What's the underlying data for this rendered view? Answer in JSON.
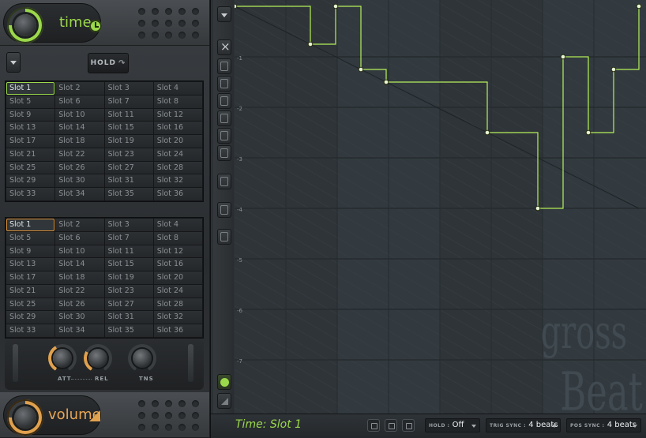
{
  "time_section": {
    "title": "time",
    "clock_icon": "clock-icon",
    "hold_label": "HOLD"
  },
  "time_slots": [
    "Slot 1",
    "Slot 2",
    "Slot 3",
    "Slot 4",
    "Slot 5",
    "Slot 6",
    "Slot 7",
    "Slot 8",
    "Slot 9",
    "Slot 10",
    "Slot 11",
    "Slot 12",
    "Slot 13",
    "Slot 14",
    "Slot 15",
    "Slot 16",
    "Slot 17",
    "Slot 18",
    "Slot 19",
    "Slot 20",
    "Slot 21",
    "Slot 22",
    "Slot 23",
    "Slot 24",
    "Slot 25",
    "Slot 26",
    "Slot 27",
    "Slot 28",
    "Slot 29",
    "Slot 30",
    "Slot 31",
    "Slot 32",
    "Slot 33",
    "Slot 34",
    "Slot 35",
    "Slot 36"
  ],
  "time_selected_slot": "Slot 1",
  "volume_slots": [
    "Slot 1",
    "Slot 2",
    "Slot 3",
    "Slot 4",
    "Slot 5",
    "Slot 6",
    "Slot 7",
    "Slot 8",
    "Slot 9",
    "Slot 10",
    "Slot 11",
    "Slot 12",
    "Slot 13",
    "Slot 14",
    "Slot 15",
    "Slot 16",
    "Slot 17",
    "Slot 18",
    "Slot 19",
    "Slot 20",
    "Slot 21",
    "Slot 22",
    "Slot 23",
    "Slot 24",
    "Slot 25",
    "Slot 26",
    "Slot 27",
    "Slot 28",
    "Slot 29",
    "Slot 30",
    "Slot 31",
    "Slot 32",
    "Slot 33",
    "Slot 34",
    "Slot 35",
    "Slot 36"
  ],
  "volume_selected_slot": "Slot 1",
  "knobs": {
    "att_label": "ATT",
    "rel_label": "REL",
    "tns_label": "TNS"
  },
  "volume_section": {
    "title": "volume"
  },
  "graph": {
    "y_labels": [
      "-1",
      "-2",
      "-3",
      "-4",
      "-5",
      "-6",
      "-7"
    ],
    "watermark_line1": "gross",
    "watermark_line2": "Beat",
    "colors": {
      "envelope": "#b6f05a",
      "accent_green": "#9bd84b",
      "accent_orange": "#d88f3a"
    }
  },
  "status": {
    "title": "Time: Slot 1",
    "hold_key": "HOLD :",
    "hold_value": "Off",
    "trig_key": "TRIG SYNC :",
    "trig_value": "4 beats",
    "pos_key": "POS SYNC :",
    "pos_value": "4 beats"
  }
}
